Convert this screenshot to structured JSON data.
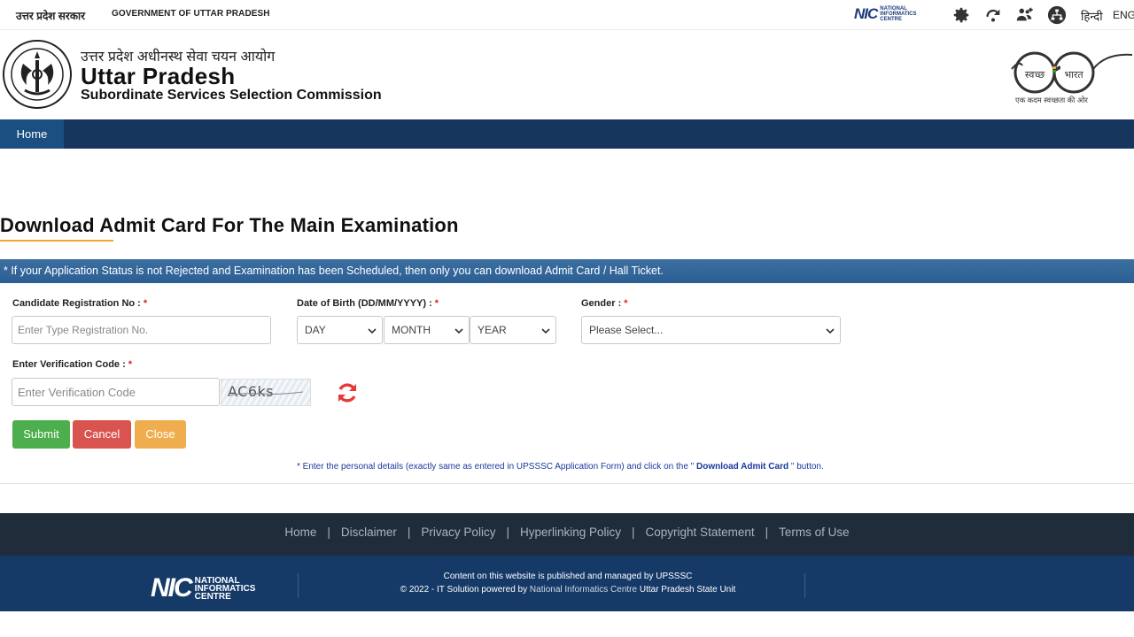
{
  "topbar": {
    "gov_hindi": "उत्तर प्रदेश सरकार",
    "gov_english": "GOVERNMENT OF UTTAR PRADESH",
    "nic_logo": "NIC",
    "nic_logo_sub": "NATIONAL INFORMATICS CENTRE",
    "icons": [
      "settings-icon",
      "skip-to-content-icon",
      "accessibility-icon",
      "sitemap-icon"
    ],
    "lang_hindi": "हिन्दी",
    "lang_english": "ENG"
  },
  "header": {
    "hindi_name": "उत्तर प्रदेश अधीनस्थ सेवा चयन आयोग",
    "title": "Uttar Pradesh",
    "subtitle": "Subordinate Services Selection Commission",
    "swachh_left": "स्वच्छ",
    "swachh_right": "भारत",
    "swachh_tagline": "एक कदम स्वच्छता की ओर"
  },
  "nav": {
    "home": "Home"
  },
  "page": {
    "title": "Download Admit Card For The Main Examination",
    "info": "* If your Application Status is not Rejected and Examination has been Scheduled, then only you can download Admit Card / Hall Ticket."
  },
  "form": {
    "reg_label": "Candidate Registration No :",
    "reg_placeholder": "Enter Type Registration No.",
    "dob_label": "Date of Birth (DD/MM/YYYY) :",
    "day": "DAY",
    "month": "MONTH",
    "year": "YEAR",
    "gender_label": "Gender :",
    "gender_selected": "Please Select...",
    "required_mark": "*",
    "code_label": "Enter Verification Code :",
    "code_placeholder": "Enter Verification Code",
    "captcha_text": "AC6ks",
    "submit": "Submit",
    "cancel": "Cancel",
    "close": "Close",
    "note_prefix": "* Enter the personal details (exactly same as entered in UPSSSC Application Form) and click on the \"",
    "note_bold": " Download Admit Card ",
    "note_suffix": "\" button."
  },
  "footer": {
    "links": [
      "Home",
      "Disclaimer",
      "Privacy Policy",
      "Hyperlinking Policy",
      "Copyright Statement",
      "Terms of Use"
    ],
    "nic_logo": "NIC",
    "nic_logo_sub": "NATIONAL INFORMATICS CENTRE",
    "line1": "Content on this website is published and managed by UPSSSC",
    "line2_prefix": "© 2022 - IT Solution powered by ",
    "line2_nic": "National Informatics Centre",
    "line2_suffix": " Uttar Pradesh State Unit"
  },
  "colors": {
    "nav": "#17365d",
    "nav_active": "#1b4f82",
    "info_bar": "#2b5f94",
    "submit": "#4cae4c",
    "cancel": "#d9534f",
    "close": "#f0ad4e",
    "required": "#dd2222",
    "refresh": "#e53935",
    "footer_links_bg": "#1f2d3b",
    "footer_bg": "#163a68"
  }
}
